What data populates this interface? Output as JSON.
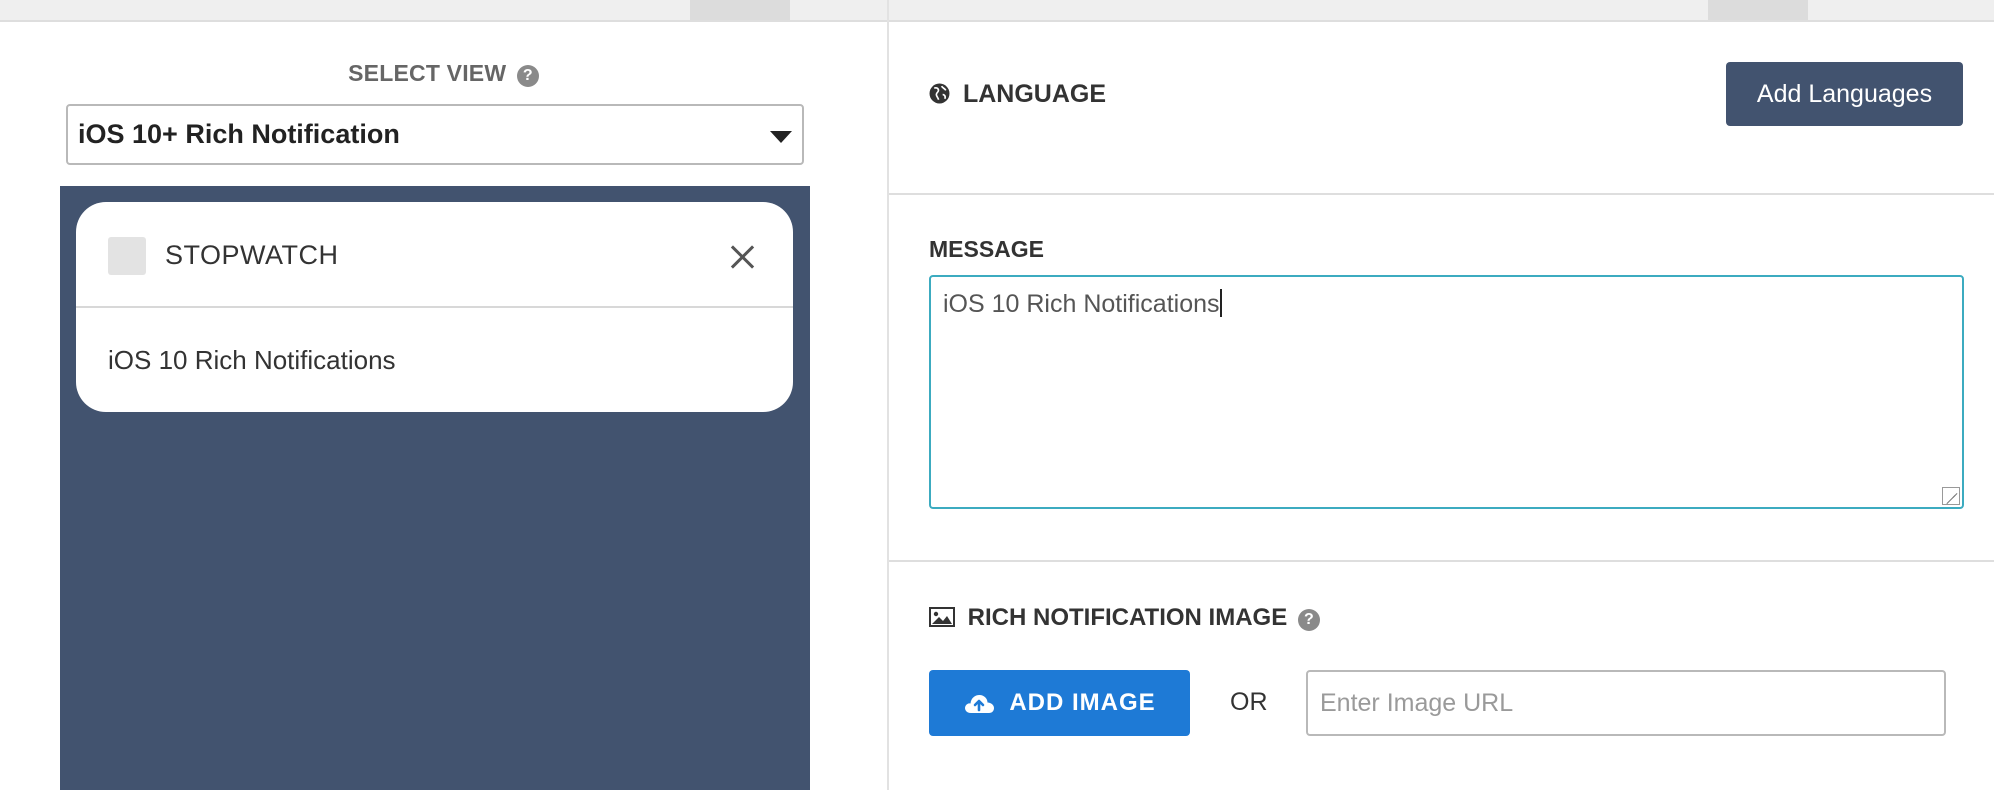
{
  "select_view": {
    "label": "SELECT VIEW",
    "help": "?",
    "selected": "iOS 10+ Rich Notification"
  },
  "preview": {
    "app_name": "STOPWATCH",
    "message": "iOS 10 Rich Notifications",
    "background_color": "#42536f"
  },
  "language": {
    "title": "LANGUAGE",
    "add_button": "Add Languages"
  },
  "message": {
    "label": "MESSAGE",
    "value": "iOS 10 Rich Notifications"
  },
  "rich_image": {
    "title": "RICH NOTIFICATION IMAGE",
    "help": "?",
    "add_button": "ADD IMAGE",
    "or_text": "OR",
    "url_placeholder": "Enter Image URL"
  },
  "colors": {
    "primary_button": "#1e7ad6",
    "secondary_button": "#42536f",
    "focus_border": "#3cabc0"
  }
}
